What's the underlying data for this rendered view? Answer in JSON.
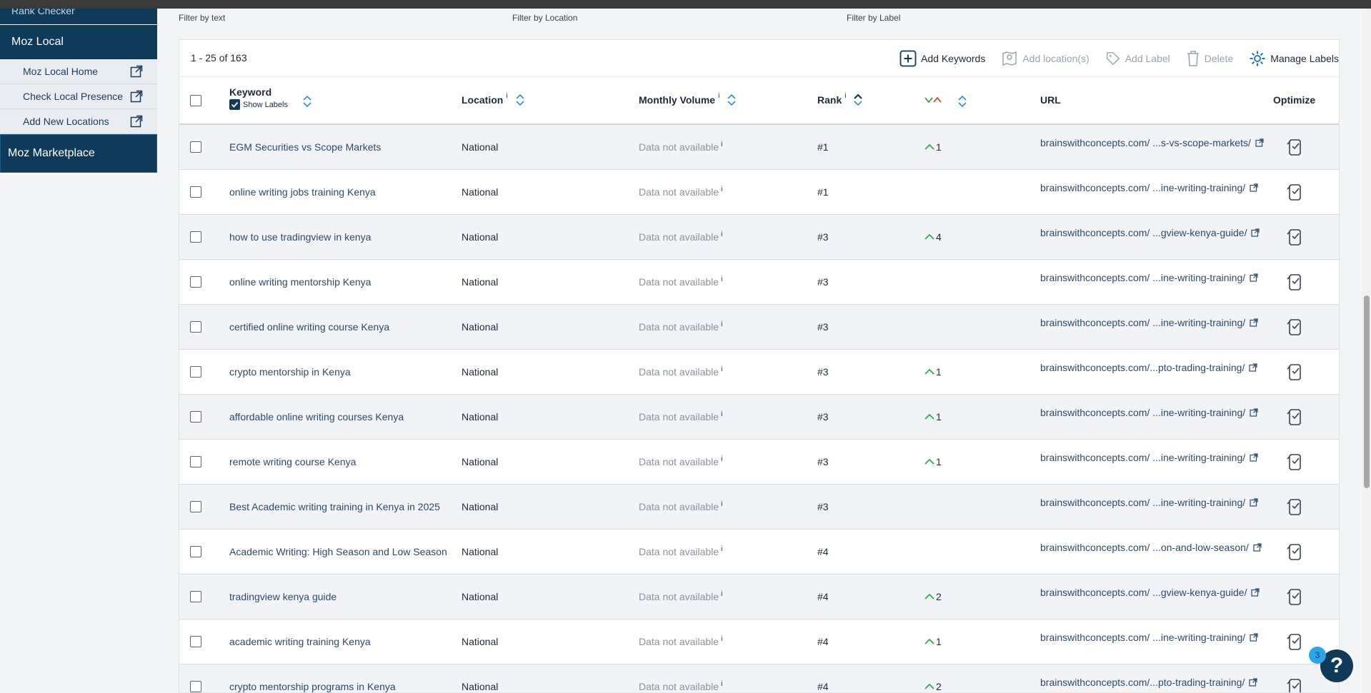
{
  "sidebar": {
    "cut_item": "Rank Checker",
    "section": "Moz Local",
    "items": [
      {
        "label": "Moz Local Home"
      },
      {
        "label": "Check Local Presence"
      },
      {
        "label": "Add New Locations"
      }
    ],
    "marketplace": "Moz Marketplace"
  },
  "filters": {
    "text": "Filter by text",
    "location": "Filter by Location",
    "label": "Filter by Label"
  },
  "toolbar": {
    "count": "1 - 25 of 163",
    "add_keywords": "Add Keywords",
    "add_locations": "Add location(s)",
    "add_label": "Add Label",
    "delete": "Delete",
    "manage_labels": "Manage Labels"
  },
  "table": {
    "headers": {
      "keyword": "Keyword",
      "show_labels": "Show Labels",
      "location": "Location",
      "monthly_volume": "Monthly Volume",
      "rank": "Rank",
      "url": "URL",
      "optimize": "Optimize",
      "info": "i"
    },
    "rows": [
      {
        "keyword": "EGM Securities vs Scope Markets",
        "location": "National",
        "volume": "Data not available",
        "rank": "#1",
        "change": "1",
        "url": "brainswithconcepts.com/ ...s-vs-scope-markets/"
      },
      {
        "keyword": "online writing jobs training Kenya",
        "location": "National",
        "volume": "Data not available",
        "rank": "#1",
        "change": "",
        "url": "brainswithconcepts.com/ ...ine-writing-training/"
      },
      {
        "keyword": "how to use tradingview in kenya",
        "location": "National",
        "volume": "Data not available",
        "rank": "#3",
        "change": "4",
        "url": "brainswithconcepts.com/ ...gview-kenya-guide/"
      },
      {
        "keyword": "online writing mentorship Kenya",
        "location": "National",
        "volume": "Data not available",
        "rank": "#3",
        "change": "",
        "url": "brainswithconcepts.com/ ...ine-writing-training/"
      },
      {
        "keyword": "certified online writing course Kenya",
        "location": "National",
        "volume": "Data not available",
        "rank": "#3",
        "change": "",
        "url": "brainswithconcepts.com/ ...ine-writing-training/"
      },
      {
        "keyword": "crypto mentorship in Kenya",
        "location": "National",
        "volume": "Data not available",
        "rank": "#3",
        "change": "1",
        "url": "brainswithconcepts.com/...pto-trading-training/"
      },
      {
        "keyword": "affordable online writing courses Kenya",
        "location": "National",
        "volume": "Data not available",
        "rank": "#3",
        "change": "1",
        "url": "brainswithconcepts.com/ ...ine-writing-training/"
      },
      {
        "keyword": "remote writing course Kenya",
        "location": "National",
        "volume": "Data not available",
        "rank": "#3",
        "change": "1",
        "url": "brainswithconcepts.com/ ...ine-writing-training/"
      },
      {
        "keyword": "Best Academic writing training in Kenya in 2025",
        "location": "National",
        "volume": "Data not available",
        "rank": "#3",
        "change": "",
        "url": "brainswithconcepts.com/ ...ine-writing-training/"
      },
      {
        "keyword": "Academic Writing: High Season and Low Season",
        "location": "National",
        "volume": "Data not available",
        "rank": "#4",
        "change": "",
        "url": "brainswithconcepts.com/ ...on-and-low-season/"
      },
      {
        "keyword": "tradingview kenya guide",
        "location": "National",
        "volume": "Data not available",
        "rank": "#4",
        "change": "2",
        "url": "brainswithconcepts.com/ ...gview-kenya-guide/"
      },
      {
        "keyword": "academic writing training Kenya",
        "location": "National",
        "volume": "Data not available",
        "rank": "#4",
        "change": "1",
        "url": "brainswithconcepts.com/ ...ine-writing-training/"
      },
      {
        "keyword": "crypto mentorship programs in Kenya",
        "location": "National",
        "volume": "Data not available",
        "rank": "#4",
        "change": "2",
        "url": "brainswithconcepts.com/...pto-trading-training/"
      }
    ]
  },
  "help": {
    "badge": "3",
    "symbol": "?"
  },
  "colors": {
    "navy": "#0f3a5a",
    "up_green": "#2faa4a",
    "down_red": "#e04848",
    "sort_blue": "#2a8fd6"
  },
  "icons": [
    "external-link-icon",
    "plus-icon",
    "location-icon",
    "tag-icon",
    "trash-icon",
    "gear-icon",
    "sort-icon",
    "arrow-up-icon",
    "optimize-icon",
    "help-icon"
  ]
}
